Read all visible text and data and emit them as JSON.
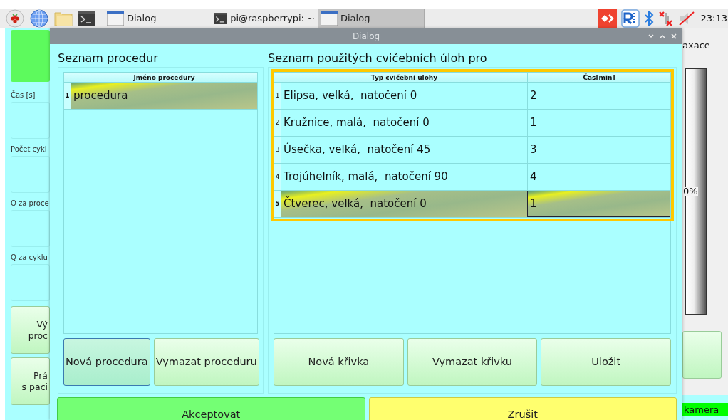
{
  "taskbar": {
    "tasks": [
      {
        "label": "Dialog",
        "kind": "window",
        "selected": false
      },
      {
        "label": "pi@raspberrypi: ~",
        "kind": "terminal",
        "selected": false
      },
      {
        "label": "Dialog",
        "kind": "window",
        "selected": true
      }
    ],
    "clock": "23:13"
  },
  "background_window": {
    "fields": [
      "Čas [s]",
      "Počet cykl",
      "Q za proce",
      "Q za cyklu"
    ],
    "buttons": [
      {
        "lines": [
          "Vý",
          "proc"
        ]
      },
      {
        "lines": [
          "Prá",
          "s paci"
        ]
      }
    ],
    "right_label": "axace",
    "gauge_reading": "0%",
    "camera_label": "kamera"
  },
  "dialog": {
    "title": "Dialog",
    "procedures": {
      "title": "Seznam procedur",
      "columns": [
        "Jméno procedury"
      ],
      "rows": [
        {
          "number": "1",
          "name": "procedura",
          "selected": true
        }
      ],
      "buttons": [
        {
          "label": "Nová procedura",
          "focused": true
        },
        {
          "label": "Vymazat proceduru",
          "focused": false
        }
      ]
    },
    "tasks": {
      "title": "Seznam použitých cvičebních úloh pro",
      "focused": true,
      "columns": [
        "Typ cvičební úlohy",
        "Čas[min]"
      ],
      "rows": [
        {
          "number": "1",
          "type": "Elipsa, velká,  natočení 0",
          "time": "2",
          "selected": false,
          "time_current": false
        },
        {
          "number": "2",
          "type": "Kružnice, malá,  natočení 0",
          "time": "1",
          "selected": false,
          "time_current": false
        },
        {
          "number": "3",
          "type": "Úsečka, velká,  natočení 45",
          "time": "3",
          "selected": false,
          "time_current": false
        },
        {
          "number": "4",
          "type": "Trojúhelník, malá,  natočení 90",
          "time": "4",
          "selected": false,
          "time_current": false
        },
        {
          "number": "5",
          "type": "Čtverec, velká,  natočení 0",
          "time": "1",
          "selected": true,
          "time_current": true
        }
      ],
      "buttons": [
        {
          "label": "Nová křivka",
          "focused": false
        },
        {
          "label": "Vymazat křivku",
          "focused": false
        },
        {
          "label": "Uložit",
          "focused": false
        }
      ]
    },
    "buttons": [
      {
        "label": "Akceptovat",
        "kind": "accept"
      },
      {
        "label": "Zrušit",
        "kind": "cancel"
      }
    ]
  }
}
